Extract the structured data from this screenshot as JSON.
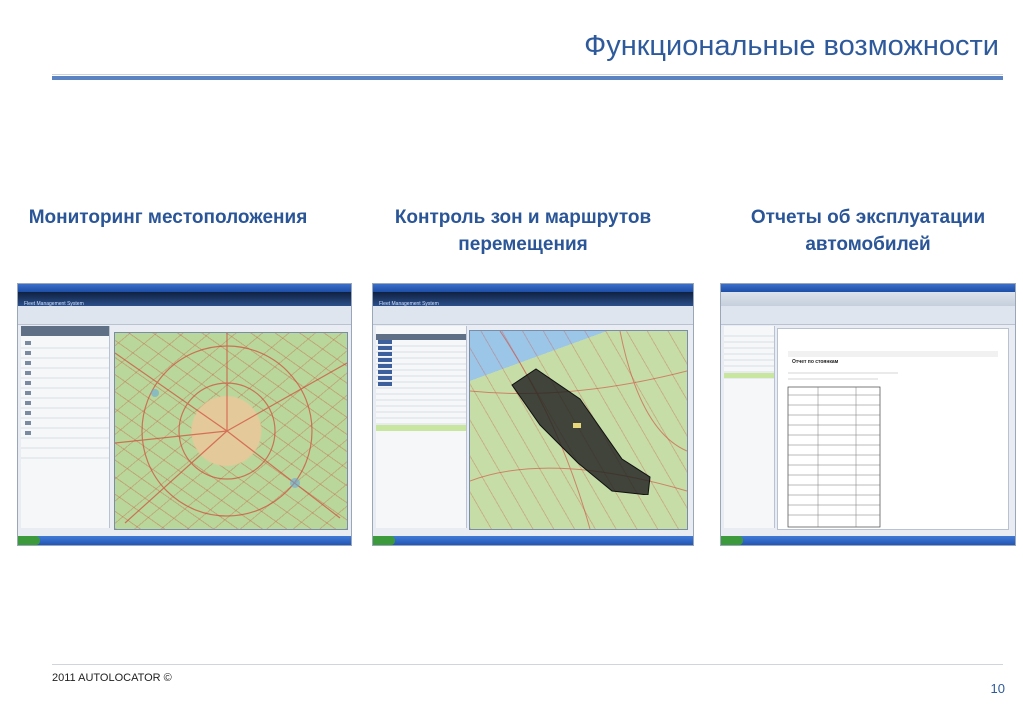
{
  "slide": {
    "title": "Функциональные возможности",
    "footer": "2011 AUTOLOCATOR ©",
    "page_number": "10"
  },
  "sections": [
    {
      "caption": "Мониторинг местоположения"
    },
    {
      "caption": "Контроль зон и маршрутов перемещения"
    },
    {
      "caption": "Отчеты об эксплуатации автомобилей"
    }
  ],
  "screenshots": {
    "app_name": "Fleet Management System",
    "report_title": "Отчет по стоянкам"
  },
  "colors": {
    "title": "#2e5a9c",
    "caption": "#2a5597",
    "rule": "#5b82c1"
  }
}
